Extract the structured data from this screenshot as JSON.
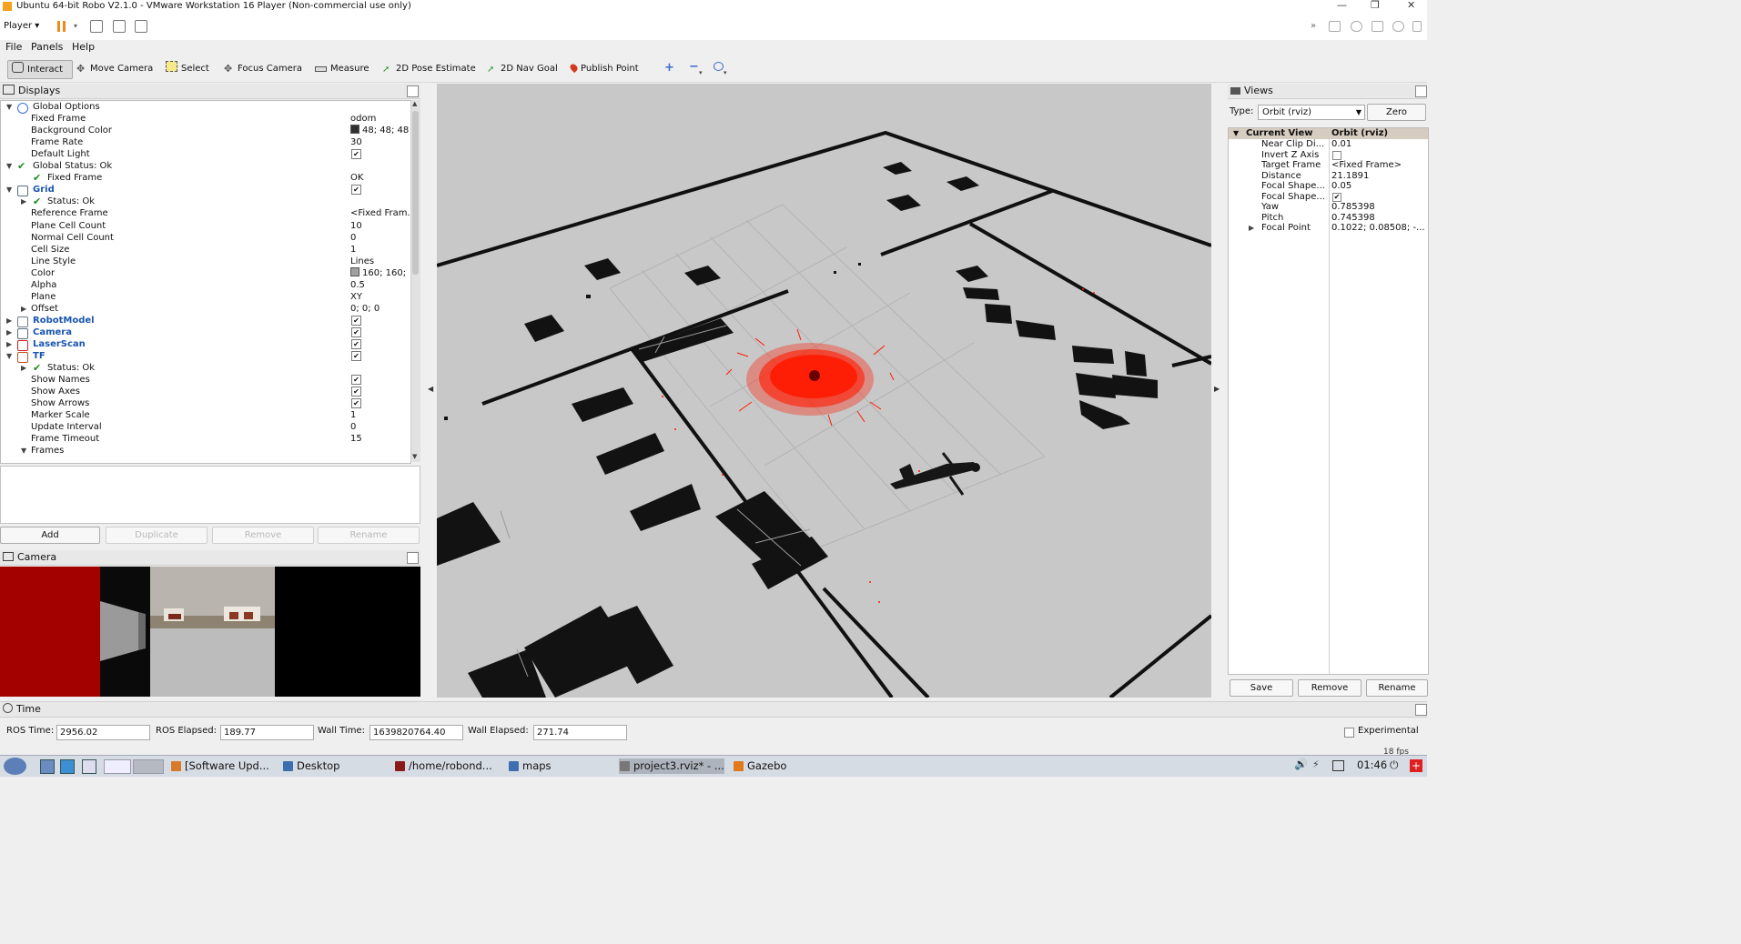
{
  "window": {
    "title": "Ubuntu 64-bit Robo V2.1.0 - VMware Workstation 16 Player (Non-commercial use only)"
  },
  "vmware": {
    "player_menu": "Player"
  },
  "menu": [
    "File",
    "Panels",
    "Help"
  ],
  "toolbar": [
    {
      "label": "Interact",
      "icon": "cursor-hand-icon",
      "active": true
    },
    {
      "label": "Move Camera",
      "icon": "move-camera-icon"
    },
    {
      "label": "Select",
      "icon": "select-box-icon"
    },
    {
      "label": "Focus Camera",
      "icon": "focus-camera-icon"
    },
    {
      "label": "Measure",
      "icon": "ruler-icon"
    },
    {
      "label": "2D Pose Estimate",
      "icon": "green-arrow-icon"
    },
    {
      "label": "2D Nav Goal",
      "icon": "green-arrow-icon"
    },
    {
      "label": "Publish Point",
      "icon": "map-pin-icon"
    }
  ],
  "displays": {
    "title": "Displays",
    "rows": [
      {
        "label": "Global Options",
        "indent": 0,
        "expand": "open",
        "icon": "globe-icon"
      },
      {
        "label": "Fixed Frame",
        "indent": 1,
        "value": "odom"
      },
      {
        "label": "Background Color",
        "indent": 1,
        "value": "48; 48; 48",
        "swatch": "#303030"
      },
      {
        "label": "Frame Rate",
        "indent": 1,
        "value": "30"
      },
      {
        "label": "Default Light",
        "indent": 1,
        "check": true
      },
      {
        "label": "Global Status: Ok",
        "indent": 0,
        "expand": "open",
        "tick": true
      },
      {
        "label": "Fixed Frame",
        "indent": 1,
        "tick": true,
        "value": "OK"
      },
      {
        "label": "Grid",
        "indent": 0,
        "expand": "open",
        "bold": true,
        "icon": "grid-icon",
        "check": true
      },
      {
        "label": "Status: Ok",
        "indent": 1,
        "expand": "closed",
        "tick": true
      },
      {
        "label": "Reference Frame",
        "indent": 1,
        "value": "<Fixed Fram..."
      },
      {
        "label": "Plane Cell Count",
        "indent": 1,
        "value": "10"
      },
      {
        "label": "Normal Cell Count",
        "indent": 1,
        "value": "0"
      },
      {
        "label": "Cell Size",
        "indent": 1,
        "value": "1"
      },
      {
        "label": "Line Style",
        "indent": 1,
        "value": "Lines"
      },
      {
        "label": "Color",
        "indent": 1,
        "value": "160; 160;",
        "swatch": "#a0a0a0"
      },
      {
        "label": "Alpha",
        "indent": 1,
        "value": "0.5"
      },
      {
        "label": "Plane",
        "indent": 1,
        "value": "XY"
      },
      {
        "label": "Offset",
        "indent": 1,
        "expand": "closed",
        "value": "0; 0; 0"
      },
      {
        "label": "RobotModel",
        "indent": 0,
        "expand": "closed",
        "bold": true,
        "icon": "robot-icon",
        "check": true
      },
      {
        "label": "Camera",
        "indent": 0,
        "expand": "closed",
        "bold": true,
        "icon": "camera-icon",
        "check": true
      },
      {
        "label": "LaserScan",
        "indent": 0,
        "expand": "closed",
        "bold": true,
        "icon": "laser-icon",
        "check": true
      },
      {
        "label": "TF",
        "indent": 0,
        "expand": "open",
        "bold": true,
        "icon": "tf-axes-icon",
        "check": true
      },
      {
        "label": "Status: Ok",
        "indent": 1,
        "expand": "closed",
        "tick": true
      },
      {
        "label": "Show Names",
        "indent": 1,
        "check": true
      },
      {
        "label": "Show Axes",
        "indent": 1,
        "check": true
      },
      {
        "label": "Show Arrows",
        "indent": 1,
        "check": true
      },
      {
        "label": "Marker Scale",
        "indent": 1,
        "value": "1"
      },
      {
        "label": "Update Interval",
        "indent": 1,
        "value": "0"
      },
      {
        "label": "Frame Timeout",
        "indent": 1,
        "value": "15"
      },
      {
        "label": "Frames",
        "indent": 1,
        "expand": "open"
      }
    ],
    "buttons": {
      "add": "Add",
      "duplicate": "Duplicate",
      "remove": "Remove",
      "rename": "Rename"
    }
  },
  "camera_panel": {
    "title": "Camera"
  },
  "views": {
    "title": "Views",
    "type_label": "Type:",
    "type_value": "Orbit (rviz)",
    "zero": "Zero",
    "header": {
      "label": "Current View",
      "value": "Orbit (rviz)"
    },
    "rows": [
      {
        "label": "Near Clip Di...",
        "value": "0.01"
      },
      {
        "label": "Invert Z Axis",
        "check": false
      },
      {
        "label": "Target Frame",
        "value": "<Fixed Frame>"
      },
      {
        "label": "Distance",
        "value": "21.1891"
      },
      {
        "label": "Focal Shape...",
        "value": "0.05"
      },
      {
        "label": "Focal Shape...",
        "check": true
      },
      {
        "label": "Yaw",
        "value": "0.785398"
      },
      {
        "label": "Pitch",
        "value": "0.745398"
      },
      {
        "label": "Focal Point",
        "value": "0.1022; 0.08508; -...",
        "expand": "closed"
      }
    ],
    "buttons": {
      "save": "Save",
      "remove": "Remove",
      "rename": "Rename"
    }
  },
  "time": {
    "title": "Time",
    "ros_time_label": "ROS Time:",
    "ros_time": "2956.02",
    "ros_elapsed_label": "ROS Elapsed:",
    "ros_elapsed": "189.77",
    "wall_time_label": "Wall Time:",
    "wall_time": "1639820764.40",
    "wall_elapsed_label": "Wall Elapsed:",
    "wall_elapsed": "271.74",
    "experimental": "Experimental",
    "fps": "18 fps"
  },
  "taskbar": {
    "items": [
      "[Software Upd...",
      "Desktop",
      "/home/robond...",
      "maps",
      "project3.rviz* - ...",
      "Gazebo"
    ],
    "clock": "01:46"
  },
  "colors": {
    "accent_bold": "#1a55b0",
    "laser": "#ff1a00",
    "floor": "#c8c8c8",
    "wall": "#111111",
    "camera_red": "#a00000"
  }
}
